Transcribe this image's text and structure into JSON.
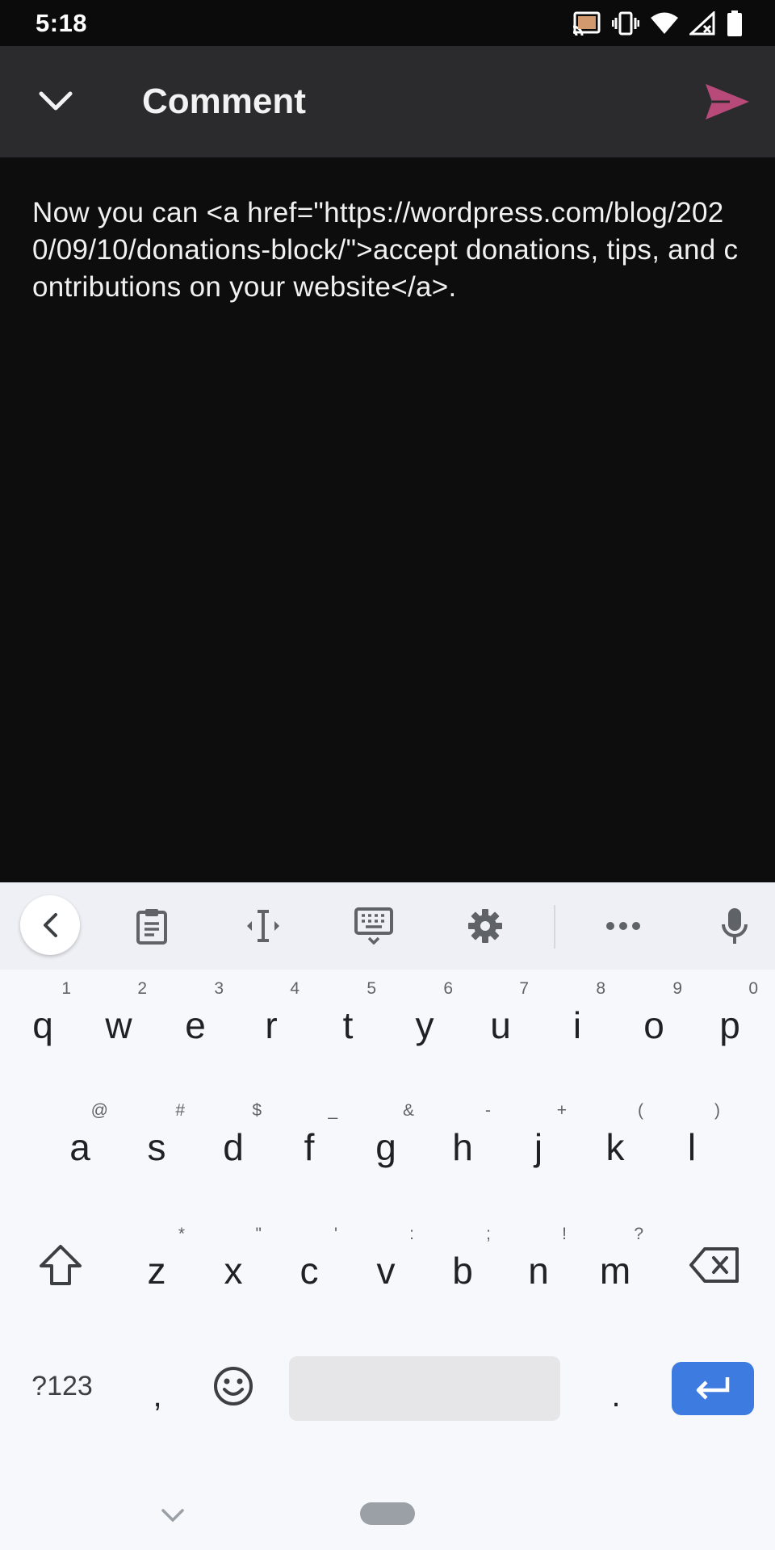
{
  "status_bar": {
    "time": "5:18",
    "icons": [
      "cast-icon",
      "vibrate-icon",
      "wifi-icon",
      "signal-no-data-icon",
      "battery-icon"
    ]
  },
  "app_bar": {
    "title": "Comment",
    "back_icon": "chevron-down-icon",
    "send_icon": "send-icon",
    "accent_color": "#b84a79"
  },
  "editor": {
    "text": "Now you can <a href=\"https://wordpress.com/blog/2020/09/10/donations-block/\">accept donations, tips, and contributions on your website</a>."
  },
  "keyboard": {
    "toolbar": [
      "chevron-left-icon",
      "clipboard-icon",
      "text-cursor-icon",
      "keyboard-icon",
      "gear-icon",
      "more-horizontal-icon",
      "microphone-icon"
    ],
    "row1": [
      {
        "key": "q",
        "hint": "1"
      },
      {
        "key": "w",
        "hint": "2"
      },
      {
        "key": "e",
        "hint": "3"
      },
      {
        "key": "r",
        "hint": "4"
      },
      {
        "key": "t",
        "hint": "5"
      },
      {
        "key": "y",
        "hint": "6"
      },
      {
        "key": "u",
        "hint": "7"
      },
      {
        "key": "i",
        "hint": "8"
      },
      {
        "key": "o",
        "hint": "9"
      },
      {
        "key": "p",
        "hint": "0"
      }
    ],
    "row2": [
      {
        "key": "a",
        "hint": "@"
      },
      {
        "key": "s",
        "hint": "#"
      },
      {
        "key": "d",
        "hint": "$"
      },
      {
        "key": "f",
        "hint": "_"
      },
      {
        "key": "g",
        "hint": "&"
      },
      {
        "key": "h",
        "hint": "-"
      },
      {
        "key": "j",
        "hint": "+"
      },
      {
        "key": "k",
        "hint": "("
      },
      {
        "key": "l",
        "hint": ")"
      }
    ],
    "row3": [
      {
        "key": "z",
        "hint": "*"
      },
      {
        "key": "x",
        "hint": "\""
      },
      {
        "key": "c",
        "hint": "'"
      },
      {
        "key": "v",
        "hint": ":"
      },
      {
        "key": "b",
        "hint": ";"
      },
      {
        "key": "n",
        "hint": "!"
      },
      {
        "key": "m",
        "hint": "?"
      }
    ],
    "symbols_label": "?123",
    "comma_label": ",",
    "period_label": ".",
    "enter_color": "#3d7be0"
  }
}
